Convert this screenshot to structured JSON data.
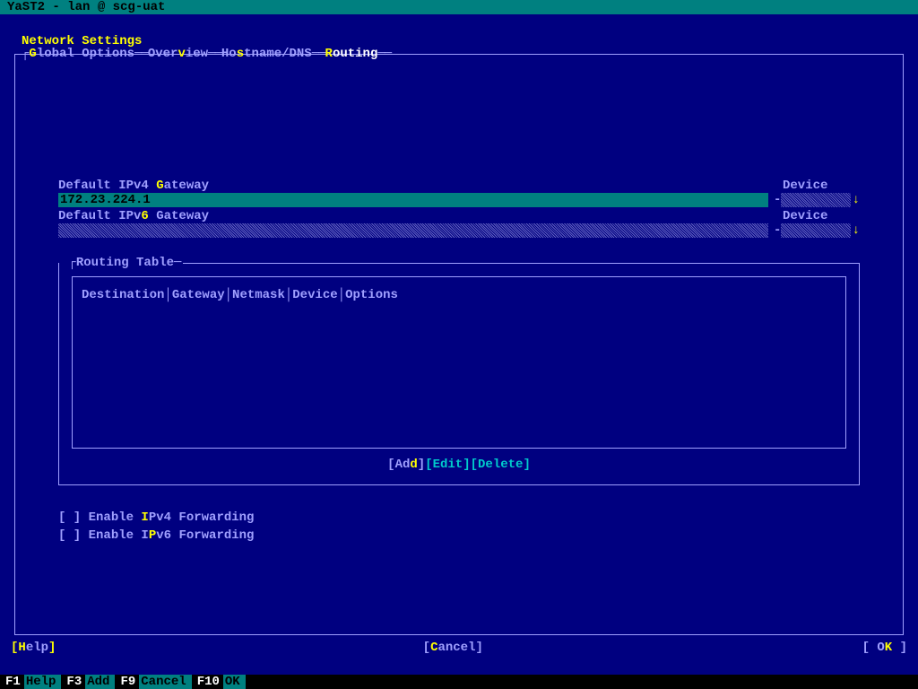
{
  "title_bar": "YaST2 - lan @ scg-uat",
  "heading": "Network Settings",
  "tabs": {
    "global": {
      "pre": "",
      "hk": "G",
      "post": "lobal Options"
    },
    "overview": {
      "pre": "Over",
      "hk": "v",
      "post": "iew"
    },
    "hostname": {
      "pre": "Ho",
      "hk": "s",
      "post": "tname/DNS"
    },
    "routing": {
      "pre": "",
      "hk": "R",
      "post": "outing"
    }
  },
  "gateway4": {
    "label_pre": "Default IPv4 ",
    "label_hk": "G",
    "label_post": "ateway",
    "value": "172.23.224.1",
    "device_label": "Device"
  },
  "gateway6": {
    "label_pre": "Default IPv",
    "label_hk": "6",
    "label_post": " Gateway",
    "value": "",
    "device_label": "Device"
  },
  "routing_table": {
    "title": "Routing Table",
    "headers": [
      "Destination",
      "Gateway",
      "Netmask",
      "Device",
      "Options"
    ],
    "rows": []
  },
  "buttons": {
    "add": {
      "pre": "Ad",
      "hk": "d",
      "post": ""
    },
    "edit": "Edit",
    "delete": "Delete"
  },
  "checkboxes": {
    "ipv4fwd": {
      "pre": "Enable ",
      "hk": "I",
      "post": "Pv4 Forwarding",
      "checked": false
    },
    "ipv6fwd": {
      "pre": "Enable I",
      "hk": "P",
      "post": "v6 Forwarding",
      "checked": false
    }
  },
  "bottom": {
    "help": {
      "hk": "H",
      "post": "elp"
    },
    "cancel": {
      "hk": "C",
      "post": "ancel"
    },
    "ok": {
      "pre": "O",
      "hk": "K"
    }
  },
  "fnbar": [
    {
      "key": "F1",
      "label": "Help"
    },
    {
      "key": "F3",
      "label": "Add"
    },
    {
      "key": "F9",
      "label": "Cancel"
    },
    {
      "key": "F10",
      "label": "OK"
    }
  ]
}
